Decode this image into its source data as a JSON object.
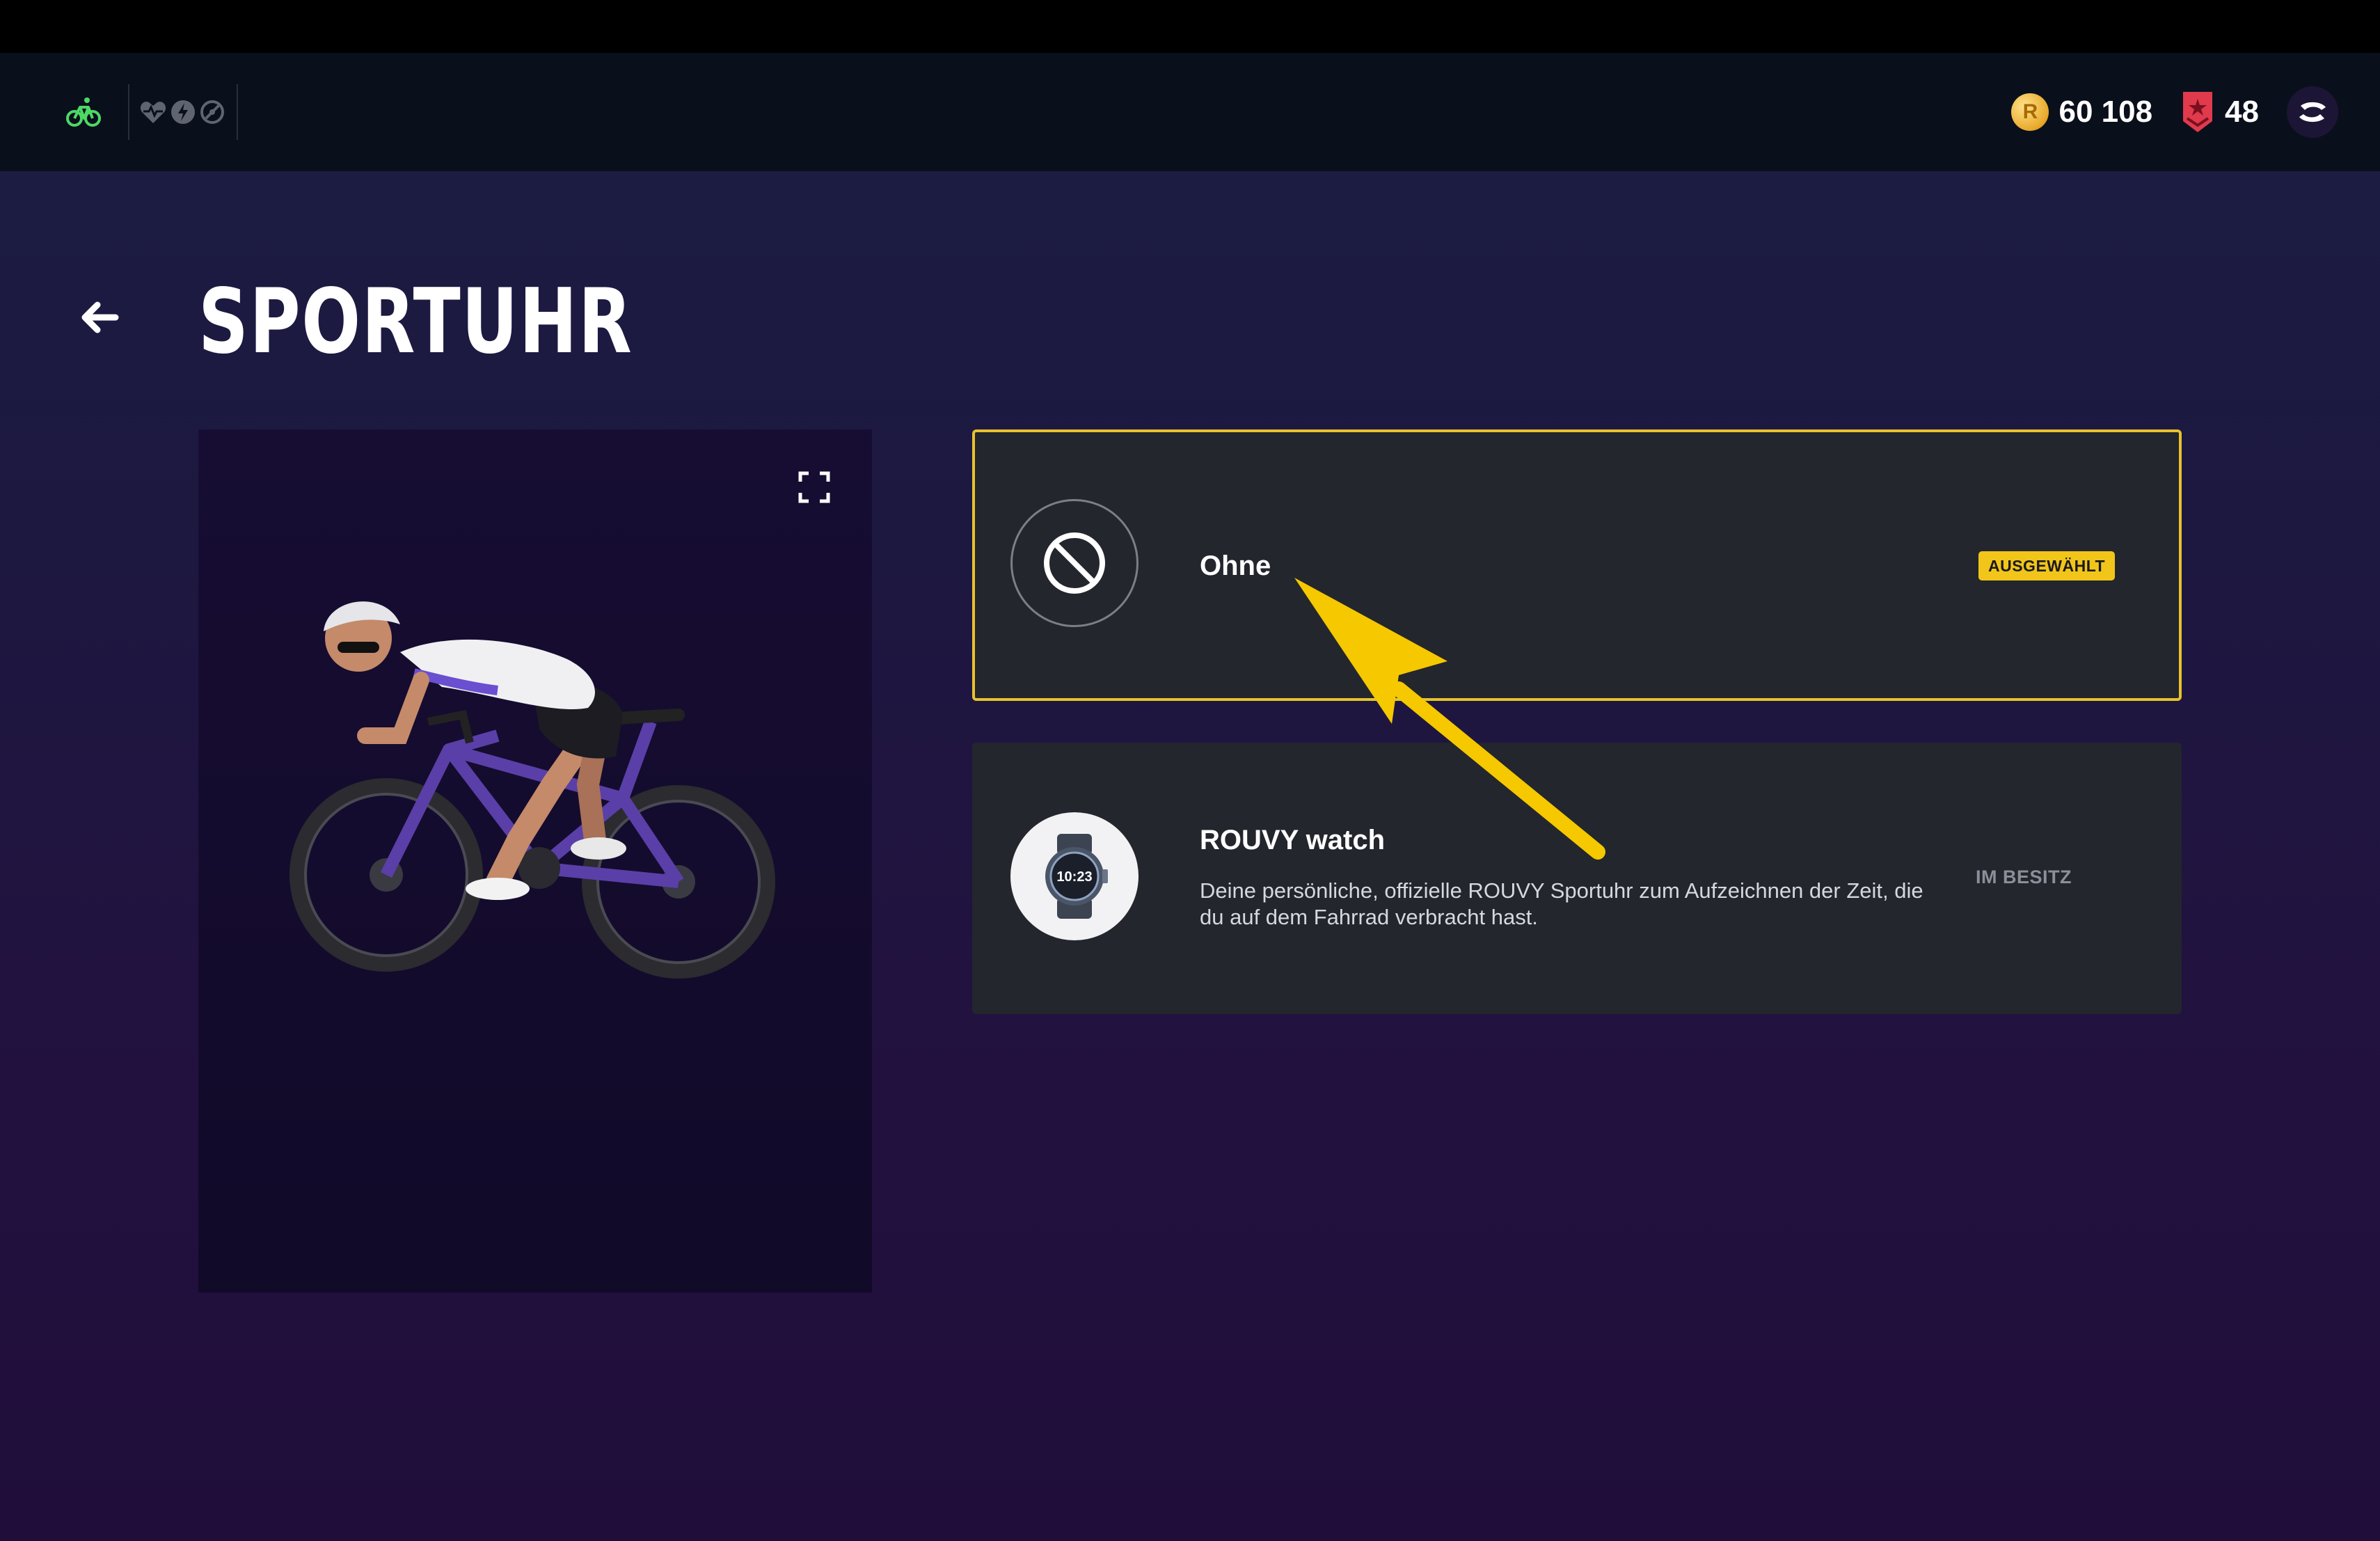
{
  "topbar": {
    "sport_icon": "bike-icon",
    "sensor_icons": [
      "heart-rate-icon",
      "power-icon",
      "cadence-icon"
    ],
    "coins": "60 108",
    "level": "48",
    "colors": {
      "sport_active": "#4cd964",
      "coin": "#e8a92a",
      "rank_badge": "#e03a4c"
    }
  },
  "page": {
    "title": "SPORTUHR",
    "back_icon": "back-arrow-icon"
  },
  "preview": {
    "fullscreen_icon": "fullscreen-icon",
    "image": "cyclist-avatar"
  },
  "options": [
    {
      "title": "Ohne",
      "status": "AUSGEWÄHLT",
      "icon": "none-icon",
      "selected": true
    },
    {
      "title": "ROUVY watch",
      "description": "Deine persönliche, offizielle ROUVY Sportuhr zum Aufzeichnen der Zeit, die du auf dem Fahrrad verbracht hast.",
      "status": "IM BESITZ",
      "icon": "watch-icon",
      "watch_face_time": "10:23",
      "selected": false
    }
  ],
  "annotation": {
    "color": "#f5c800",
    "icon": "pointer-arrow"
  }
}
